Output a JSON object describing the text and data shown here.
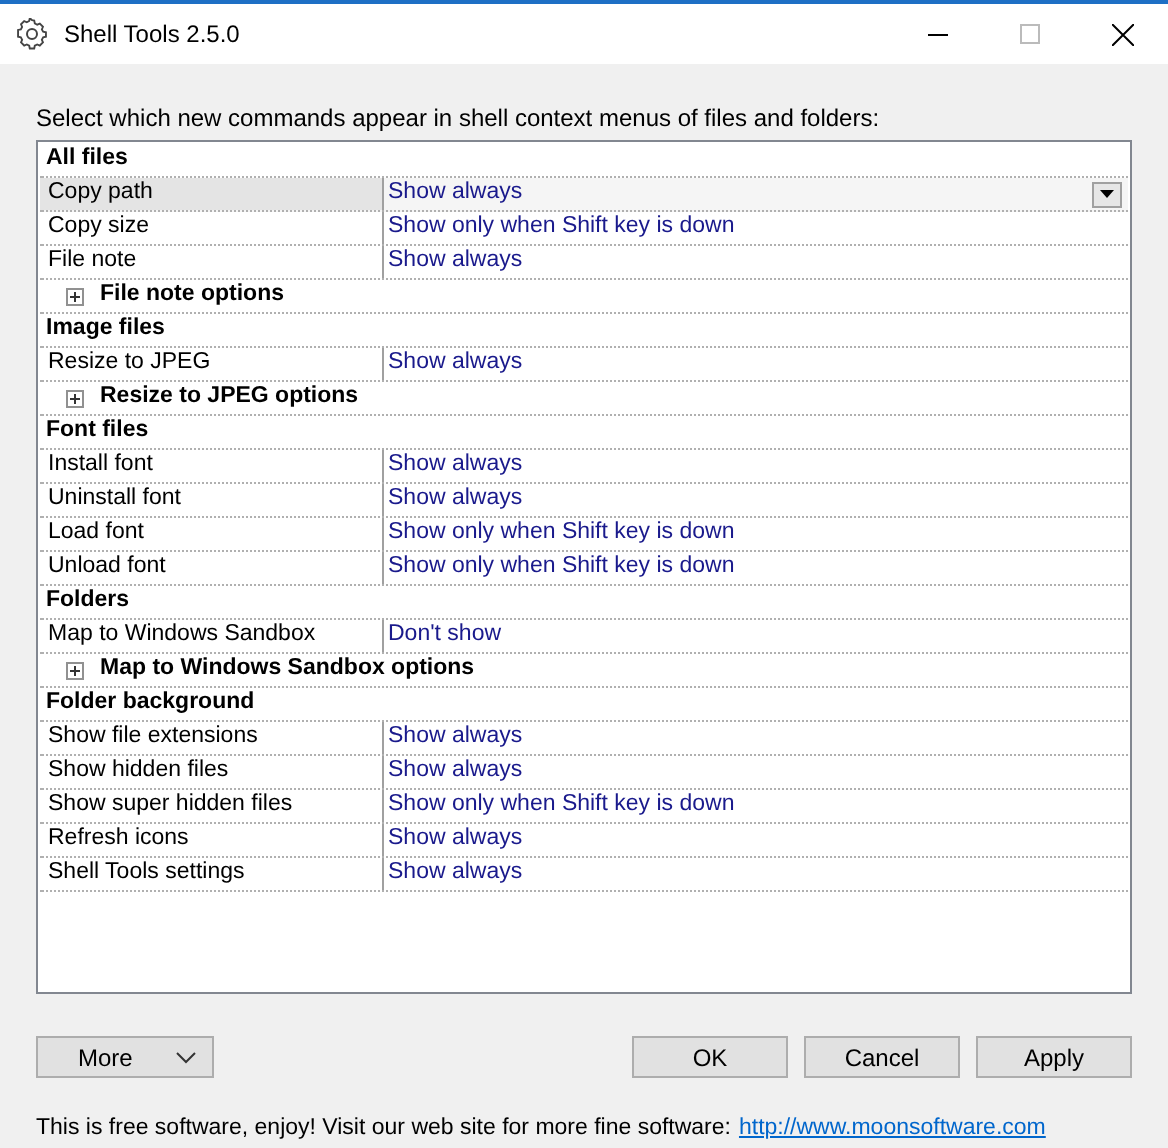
{
  "window": {
    "title": "Shell Tools 2.5.0"
  },
  "instruction": "Select which new commands appear in shell context menus of files and folders:",
  "rows": [
    {
      "kind": "category",
      "label": "All files"
    },
    {
      "kind": "item",
      "label": "Copy path",
      "value": "Show always",
      "selected": true
    },
    {
      "kind": "item",
      "label": "Copy size",
      "value": "Show only when Shift key is down",
      "selected": false
    },
    {
      "kind": "item",
      "label": "File note",
      "value": "Show always",
      "selected": false
    },
    {
      "kind": "expander",
      "label": "File note options",
      "expanded": false
    },
    {
      "kind": "category",
      "label": "Image files"
    },
    {
      "kind": "item",
      "label": "Resize to JPEG",
      "value": "Show always",
      "selected": false
    },
    {
      "kind": "expander",
      "label": "Resize to JPEG options",
      "expanded": false
    },
    {
      "kind": "category",
      "label": "Font files"
    },
    {
      "kind": "item",
      "label": "Install font",
      "value": "Show always",
      "selected": false
    },
    {
      "kind": "item",
      "label": "Uninstall font",
      "value": "Show always",
      "selected": false
    },
    {
      "kind": "item",
      "label": "Load font",
      "value": "Show only when Shift key is down",
      "selected": false
    },
    {
      "kind": "item",
      "label": "Unload font",
      "value": "Show only when Shift key is down",
      "selected": false
    },
    {
      "kind": "category",
      "label": "Folders"
    },
    {
      "kind": "item",
      "label": "Map to Windows Sandbox",
      "value": "Don't show",
      "selected": false
    },
    {
      "kind": "expander",
      "label": "Map to Windows Sandbox options",
      "expanded": false
    },
    {
      "kind": "category",
      "label": "Folder background"
    },
    {
      "kind": "item",
      "label": "Show file extensions",
      "value": "Show always",
      "selected": false
    },
    {
      "kind": "item",
      "label": "Show hidden files",
      "value": "Show always",
      "selected": false
    },
    {
      "kind": "item",
      "label": "Show super hidden files",
      "value": "Show only when Shift key is down",
      "selected": false
    },
    {
      "kind": "item",
      "label": "Refresh icons",
      "value": "Show always",
      "selected": false
    },
    {
      "kind": "item",
      "label": "Shell Tools settings",
      "value": "Show always",
      "selected": false
    }
  ],
  "more_button": "More",
  "buttons": [
    "OK",
    "Cancel",
    "Apply"
  ],
  "footer": {
    "text": "This is free software, enjoy! Visit our web site for more fine software:",
    "link": "http://www.moonsoftware.com"
  }
}
